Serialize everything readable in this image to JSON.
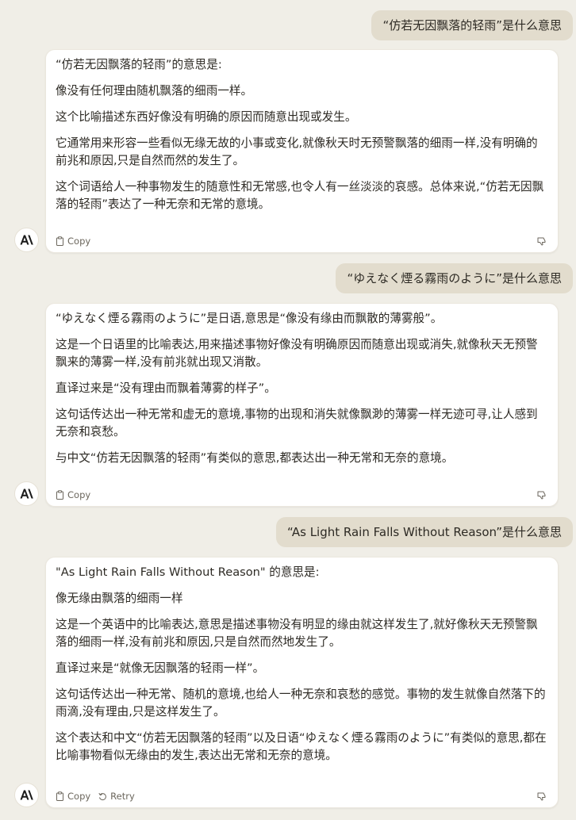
{
  "conversation": [
    {
      "user": "“仿若无因飘落的轻雨”是什么意思",
      "assistant": [
        "“仿若无因飘落的轻雨”的意思是:",
        "像没有任何理由随机飘落的细雨一样。",
        "这个比喻描述东西好像没有明确的原因而随意出现或发生。",
        "它通常用来形容一些看似无缘无故的小事或变化,就像秋天时无预警飘落的细雨一样,没有明确的前兆和原因,只是自然而然的发生了。",
        "这个词语给人一种事物发生的随意性和无常感,也令人有一丝淡淡的哀感。总体来说,“仿若无因飘落的轻雨”表达了一种无奈和无常的意境。"
      ],
      "actions": {
        "copy": "Copy"
      }
    },
    {
      "user": "“ゆえなく煙る霧雨のように”是什么意思",
      "assistant": [
        "“ゆえなく煙る霧雨のように”是日语,意思是“像没有缘由而飘散的薄雾般”。",
        "这是一个日语里的比喻表达,用来描述事物好像没有明确原因而随意出现或消失,就像秋天无预警飘来的薄雾一样,没有前兆就出现又消散。",
        "直译过来是“没有理由而飘着薄雾的样子”。",
        "这句话传达出一种无常和虚无的意境,事物的出现和消失就像飘渺的薄雾一样无迹可寻,让人感到无奈和哀愁。",
        "与中文“仿若无因飘落的轻雨”有类似的意思,都表达出一种无常和无奈的意境。"
      ],
      "actions": {
        "copy": "Copy"
      }
    },
    {
      "user": "“As Light Rain Falls Without Reason”是什么意思",
      "assistant": [
        "\"As Light Rain Falls Without Reason\" 的意思是:",
        "像无缘由飘落的细雨一样",
        "这是一个英语中的比喻表达,意思是描述事物没有明显的缘由就这样发生了,就好像秋天无预警飘落的细雨一样,没有前兆和原因,只是自然而然地发生了。",
        "直译过来是“就像无因飘落的轻雨一样”。",
        "这句话传达出一种无常、随机的意境,也给人一种无奈和哀愁的感觉。事物的发生就像自然落下的雨滴,没有理由,只是这样发生了。",
        "这个表达和中文“仿若无因飘落的轻雨”以及日语“ゆえなく煙る霧雨のように”有类似的意思,都在比喻事物看似无缘由的发生,表达出无常和无奈的意境。"
      ],
      "actions": {
        "copy": "Copy",
        "retry": "Retry"
      }
    }
  ],
  "icons": {
    "avatar": "anthropic-logo-icon",
    "copy": "clipboard-icon",
    "retry": "retry-icon",
    "feedback": "thumbs-down-icon"
  },
  "colors": {
    "background": "#f0eee7",
    "user_bubble": "#e2dccd",
    "card": "#ffffff",
    "text": "#2d2a24",
    "muted": "#6b665c"
  }
}
